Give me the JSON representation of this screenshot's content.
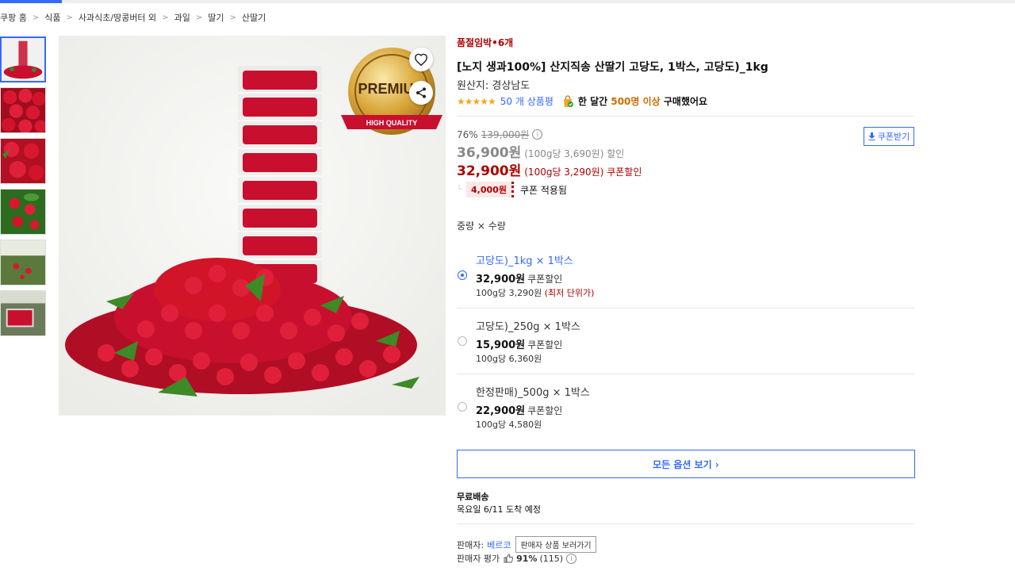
{
  "breadcrumb": [
    "쿠팡 홈",
    "식품",
    "사과식초/땅콩버터 외",
    "과일",
    "딸기",
    "산딸기"
  ],
  "breadcrumb_sep": ">",
  "product": {
    "stock_badge": "품절임박•6개",
    "title": "[노지 생과100%] 산지직송 산딸기 고당도, 1박스, 고당도)_1kg",
    "origin": "원산지: 경상남도",
    "stars": "★★★★★",
    "rating": 4.5,
    "review_count": "50 개 상품평",
    "buy_prefix": "한 달간 ",
    "buy_highlight": "500명 이상",
    "buy_suffix": " 구매했어요"
  },
  "price": {
    "discount_rate": "76%",
    "original_price": "139,000원",
    "sale_price": "36,900원",
    "sale_unit": "(100g당 3,690원) 할인",
    "coupon_price": "32,900원",
    "coupon_unit": "(100g당 3,290원) 쿠폰할인",
    "coupon_amount": "4,000원",
    "coupon_applied": "쿠폰 적용됨",
    "coupon_button": "쿠폰받기"
  },
  "options": {
    "header": "중량 × 수량",
    "items": [
      {
        "name": "고당도)_1kg × 1박스",
        "price": "32,900원",
        "coupon_label": "쿠폰할인",
        "unit": "100g당 3,290원",
        "lowest": "(최저 단위가)",
        "selected": true
      },
      {
        "name": "고당도)_250g × 1박스",
        "price": "15,900원",
        "coupon_label": "쿠폰할인",
        "unit": "100g당 6,360원",
        "lowest": "",
        "selected": false
      },
      {
        "name": "한정판매)_500g × 1박스",
        "price": "22,900원",
        "coupon_label": "쿠폰할인",
        "unit": "100g당 4,580원",
        "lowest": "",
        "selected": false
      }
    ],
    "all_button": "모든 옵션 보기 ›"
  },
  "shipping": {
    "label": "무료배송",
    "date": "목요일 6/11 도착 예정"
  },
  "seller": {
    "label": "판매자:",
    "name": "베르코",
    "button": "판매자 상품 보러가기",
    "rating_label": "판매자 평가",
    "rating_pct": "91%",
    "rating_count": "(115)"
  },
  "image": {
    "badge_top": "PREMIUM",
    "badge_bottom": "HIGH QUALITY"
  },
  "colors": {
    "accent": "#346aff",
    "price_red": "#ae0000",
    "highlight": "#cc6d00",
    "star": "#f5a623",
    "berry": "#c8102e"
  },
  "icons": {
    "favorite": "heart-icon",
    "share": "share-icon",
    "download": "download-icon",
    "info": "info-icon",
    "thumbs_up": "thumbs-up-icon"
  }
}
